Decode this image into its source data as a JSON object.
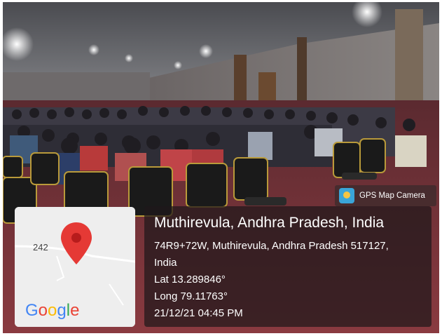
{
  "badge": {
    "app_name": "GPS Map Camera",
    "icon": "gps-map-camera-app-icon"
  },
  "map": {
    "road_label": "242",
    "logo": "Google",
    "pin_icon": "map-pin-icon",
    "pin_color": "#e53935"
  },
  "info": {
    "location_title": "Muthirevula, Andhra Pradesh, India",
    "address_line1": "74R9+72W, Muthirevula, Andhra Pradesh 517127,",
    "address_line2": "India",
    "lat": "Lat 13.289846°",
    "long": "Long 79.11763°",
    "datetime": "21/12/21 04:45 PM"
  }
}
